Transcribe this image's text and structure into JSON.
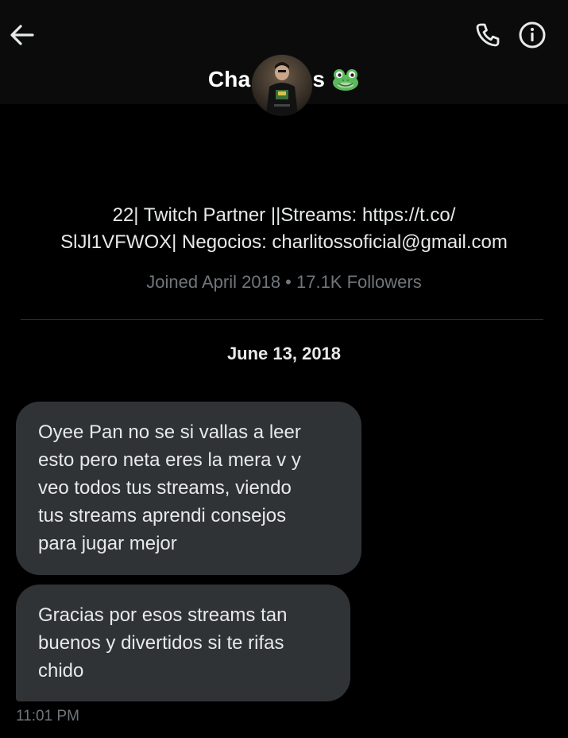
{
  "header": {
    "title": "Charlitos",
    "title_visible_left": "Cha",
    "title_visible_right": "s",
    "title_emoji_icon": "frog-face-icon",
    "back_icon": "arrow-left-icon",
    "call_icon": "phone-icon",
    "info_icon": "info-icon"
  },
  "profile": {
    "bio_line1": "22| Twitch Partner ||Streams: https://t.co/",
    "bio_line2": "SlJl1VFWOX| Negocios: charlitossoficial@gmail.com",
    "meta": "Joined April 2018 • 17.1K Followers"
  },
  "conversation": {
    "date": "June 13, 2018",
    "messages": [
      {
        "lines": [
          "Oyee Pan no se si vallas a leer",
          "esto pero neta eres la mera v y",
          "veo todos tus streams, viendo",
          "tus streams aprendi consejos",
          "para jugar mejor"
        ]
      },
      {
        "lines": [
          "Gracias por esos streams tan",
          "buenos y divertidos si te rifas",
          "chido"
        ]
      }
    ],
    "timestamp": "11:01 PM"
  },
  "colors": {
    "background": "#000000",
    "header": "#0b0b0b",
    "bubble": "#2f3336",
    "muted_text": "#71767b",
    "text": "#e7e9ea"
  }
}
